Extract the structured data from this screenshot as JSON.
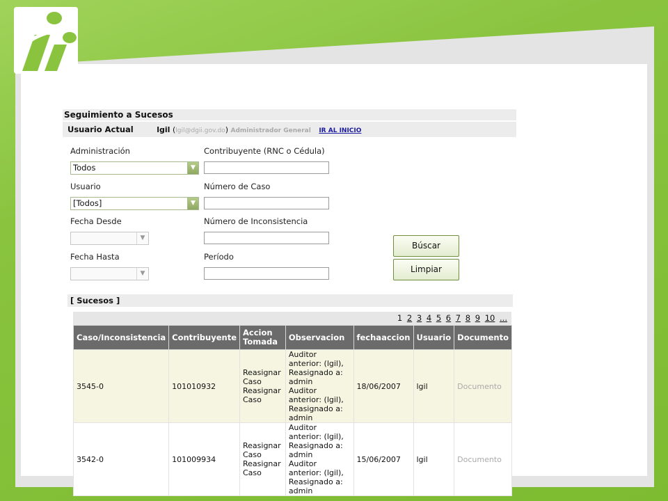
{
  "header": {
    "title": "Seguimiento a Sucesos",
    "user_label": "Usuario Actual",
    "user_name": "lgil",
    "open_paren": "(",
    "user_email": "lgil@dgii.gov.do",
    "close_paren": ")",
    "user_role": "Administrador General",
    "home_link": "IR AL INICIO"
  },
  "form": {
    "administracion_label": "Administración",
    "administracion_value": "Todos",
    "usuario_label": "Usuario",
    "usuario_value": "[Todos]",
    "fecha_desde_label": "Fecha Desde",
    "fecha_hasta_label": "Fecha Hasta",
    "contribuyente_label": "Contribuyente (RNC o Cédula)",
    "numero_caso_label": "Número de Caso",
    "numero_inconsistencia_label": "Número de Inconsistencia",
    "periodo_label": "Período",
    "buscar_label": "Búscar",
    "limpiar_label": "Limpiar"
  },
  "sucesos": {
    "section_label": "[ Sucesos ]",
    "pages": [
      "1",
      "2",
      "3",
      "4",
      "5",
      "6",
      "7",
      "8",
      "9",
      "10",
      "..."
    ],
    "columns": [
      "Caso/Inconsistencia",
      "Contribuyente",
      "Accion Tomada",
      "Observacion",
      "fechaaccion",
      "Usuario",
      "Documento"
    ],
    "rows": [
      {
        "caso": "3545-0",
        "contribuyente": "101010932",
        "accion": [
          "Reasignar",
          "Caso",
          "Reasignar",
          "Caso"
        ],
        "observacion": [
          "Auditor anterior: (lgil),",
          "Reasignado a: admin",
          "Auditor anterior: (lgil),",
          "Reasignado a: admin"
        ],
        "fecha": "18/06/2007",
        "usuario": "lgil",
        "documento": "Documento"
      },
      {
        "caso": "3542-0",
        "contribuyente": "101009934",
        "accion": [
          "Reasignar",
          "Caso",
          "Reasignar",
          "Caso"
        ],
        "observacion": [
          "Auditor anterior: (lgil),",
          "Reasignado a: admin",
          "Auditor anterior: (lgil),",
          "Reasignado a: admin"
        ],
        "fecha": "15/06/2007",
        "usuario": "lgil",
        "documento": "Documento"
      }
    ]
  },
  "colors": {
    "frame_green": "#8ac43f",
    "table_header": "#6b6b6b",
    "row_highlight": "#f5f5e2"
  },
  "icons": {
    "logo": "ii-logo-icon",
    "dropdown": "chevron-down-icon"
  }
}
